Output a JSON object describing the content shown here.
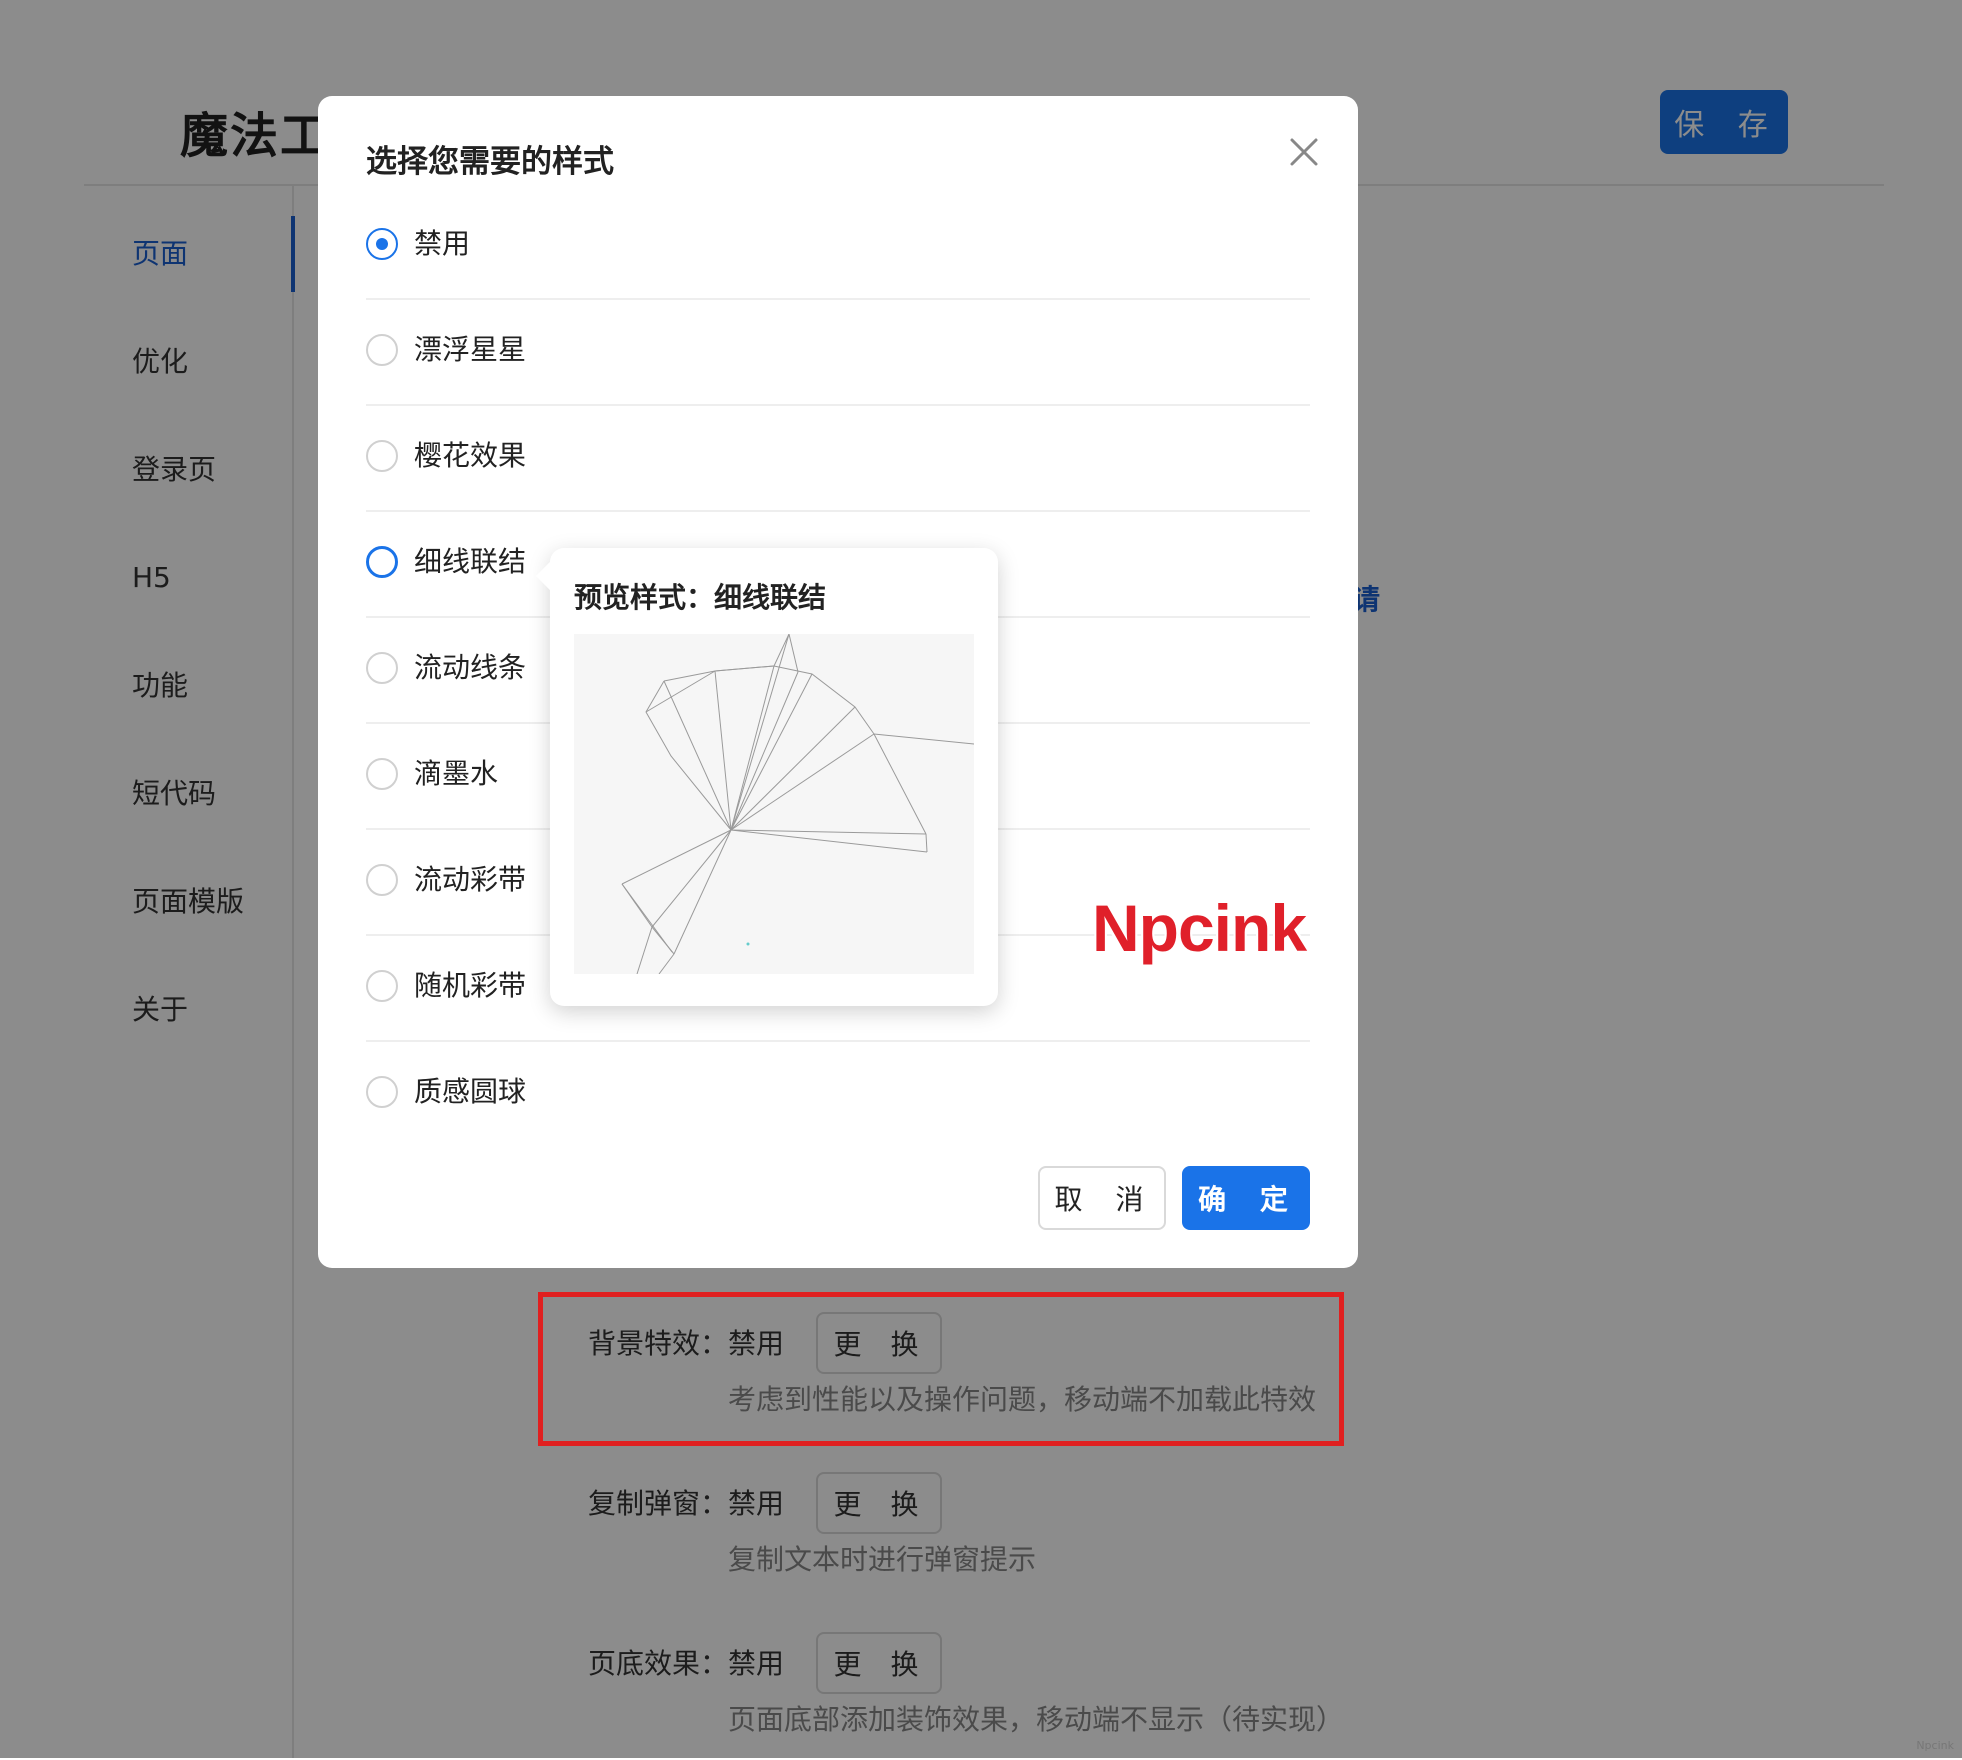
{
  "app": {
    "title": "魔法工",
    "save_label": "保 存"
  },
  "sidebar": {
    "items": [
      {
        "label": "页面"
      },
      {
        "label": "优化"
      },
      {
        "label": "登录页"
      },
      {
        "label": "H5"
      },
      {
        "label": "功能"
      },
      {
        "label": "短代码"
      },
      {
        "label": "页面模版"
      },
      {
        "label": "关于"
      }
    ]
  },
  "settings": {
    "stray_char": "请",
    "rows": [
      {
        "label": "背景特效：禁用",
        "button": "更 换",
        "desc": "考虑到性能以及操作问题，移动端不加载此特效"
      },
      {
        "label": "复制弹窗：禁用",
        "button": "更 换",
        "desc": "复制文本时进行弹窗提示"
      },
      {
        "label": "页底效果：禁用",
        "button": "更 换",
        "desc": "页面底部添加装饰效果，移动端不显示（待实现）"
      }
    ]
  },
  "modal": {
    "title": "选择您需要的样式",
    "options": [
      {
        "label": "禁用",
        "checked": true
      },
      {
        "label": "漂浮星星",
        "checked": false
      },
      {
        "label": "樱花效果",
        "checked": false
      },
      {
        "label": "细线联结",
        "checked": false
      },
      {
        "label": "流动线条",
        "checked": false
      },
      {
        "label": "滴墨水",
        "checked": false
      },
      {
        "label": "流动彩带",
        "checked": false
      },
      {
        "label": "随机彩带",
        "checked": false
      },
      {
        "label": "质感圆球",
        "checked": false
      }
    ],
    "cancel_label": "取 消",
    "ok_label": "确 定"
  },
  "preview": {
    "title": "预览样式：细线联结"
  },
  "watermark": "Npcink",
  "corner_mark": "Npcink",
  "colors": {
    "primary": "#1a73e8",
    "highlight": "#e02020",
    "mask": "rgba(0,0,0,0.45)"
  }
}
